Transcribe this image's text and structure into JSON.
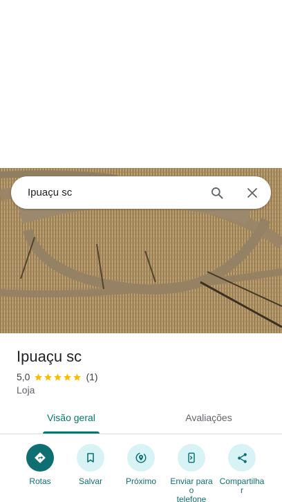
{
  "search": {
    "query": "Ipuaçu sc"
  },
  "place": {
    "name": "Ipuaçu sc",
    "rating": "5,0",
    "rating_value": 5,
    "review_count": "(1)",
    "category": "Loja"
  },
  "tabs": [
    {
      "label": "Visão geral",
      "selected": true
    },
    {
      "label": "Avaliações",
      "selected": false
    }
  ],
  "actions": [
    {
      "label": "Rotas",
      "icon": "directions-icon"
    },
    {
      "label": "Salvar",
      "icon": "bookmark-icon"
    },
    {
      "label": "Próximo",
      "icon": "nearby-icon"
    },
    {
      "label": "Enviar para\no\ntelefone",
      "icon": "send-to-phone-icon"
    },
    {
      "label": "Compartilha\nr",
      "icon": "share-icon"
    }
  ],
  "colors": {
    "accent": "#00796b",
    "action_dark": "#0e6e71",
    "action_light": "#d8f3f6",
    "star": "#fbbc04"
  }
}
